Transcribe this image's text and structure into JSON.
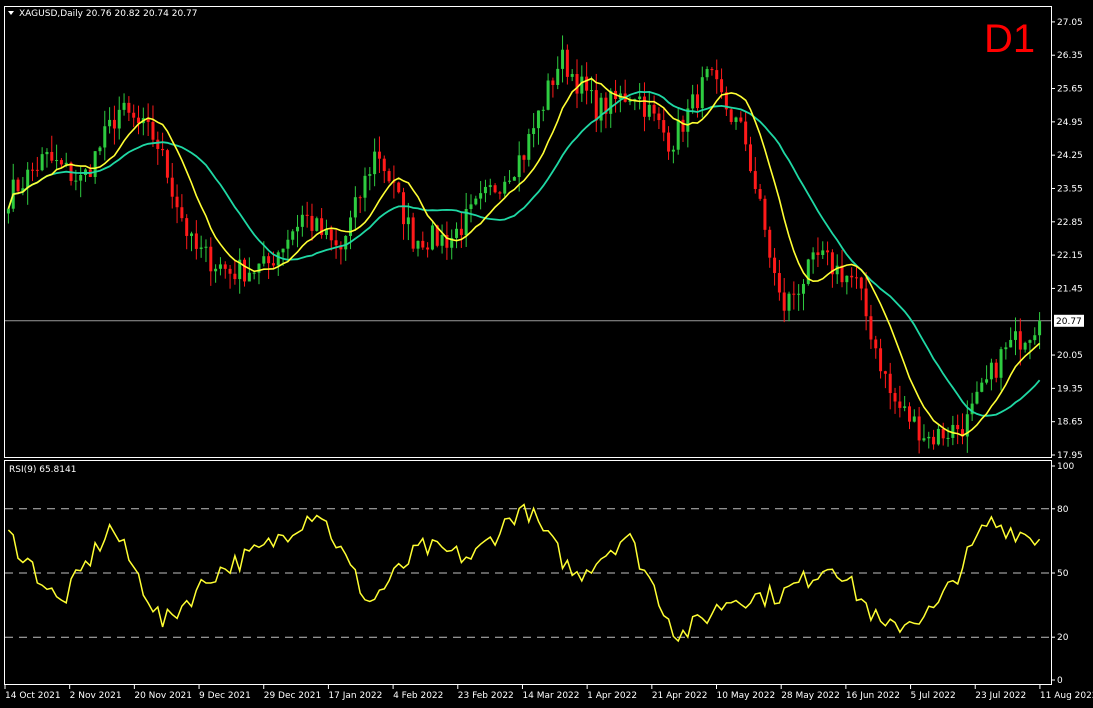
{
  "window": {
    "symbol_line": "XAGUSD,Daily  20.76 20.82 20.74 20.77",
    "timeframe_badge": "D1",
    "collapse_icon": "triangle-down-icon"
  },
  "price_scale": {
    "ticks": [
      "27.05",
      "26.35",
      "25.65",
      "24.95",
      "24.25",
      "23.55",
      "22.85",
      "22.15",
      "21.45",
      "20.05",
      "19.35",
      "18.65",
      "17.95"
    ],
    "current_price_label": "20.77"
  },
  "rsi_panel": {
    "title": "RSI(9) 65.8141",
    "ticks": [
      "100",
      "80",
      "50",
      "20",
      "0"
    ]
  },
  "time_scale": {
    "labels": [
      "14 Oct 2021",
      "2 Nov 2021",
      "20 Nov 2021",
      "9 Dec 2021",
      "29 Dec 2021",
      "17 Jan 2022",
      "4 Feb 2022",
      "23 Feb 2022",
      "14 Mar 2022",
      "1 Apr 2022",
      "21 Apr 2022",
      "10 May 2022",
      "28 May 2022",
      "16 Jun 2022",
      "5 Jul 2022",
      "23 Jul 2022",
      "11 Aug 2022"
    ]
  },
  "colors": {
    "background": "#000000",
    "bull_candle": "#2ecc40",
    "bear_candle": "#ff1a1a",
    "ma_fast": "#ffff33",
    "ma_slow": "#1fd8a4",
    "rsi_line": "#ffff33",
    "d1_badge": "#ff0000"
  },
  "chart_data": [
    {
      "type": "candlestick",
      "title": "XAGUSD,Daily",
      "series_keypoints": [
        {
          "x": "14 Oct 2021",
          "close": 23.4
        },
        {
          "x": "22 Oct 2021",
          "close": 24.2
        },
        {
          "x": "2 Nov 2021",
          "close": 23.7
        },
        {
          "x": "12 Nov 2021",
          "close": 25.2
        },
        {
          "x": "20 Nov 2021",
          "close": 24.6
        },
        {
          "x": "2 Dec 2021",
          "close": 22.3
        },
        {
          "x": "9 Dec 2021",
          "close": 21.8
        },
        {
          "x": "15 Dec 2021",
          "close": 21.9
        },
        {
          "x": "29 Dec 2021",
          "close": 23.0
        },
        {
          "x": "6 Jan 2022",
          "close": 22.2
        },
        {
          "x": "17 Jan 2022",
          "close": 24.4
        },
        {
          "x": "27 Jan 2022",
          "close": 22.5
        },
        {
          "x": "4 Feb 2022",
          "close": 22.5
        },
        {
          "x": "14 Feb 2022",
          "close": 23.4
        },
        {
          "x": "23 Feb 2022",
          "close": 24.3
        },
        {
          "x": "7 Mar 2022",
          "close": 26.3
        },
        {
          "x": "14 Mar 2022",
          "close": 25.2
        },
        {
          "x": "24 Mar 2022",
          "close": 25.6
        },
        {
          "x": "1 Apr 2022",
          "close": 24.5
        },
        {
          "x": "18 Apr 2022",
          "close": 25.9
        },
        {
          "x": "21 Apr 2022",
          "close": 24.6
        },
        {
          "x": "10 May 2022",
          "close": 21.0
        },
        {
          "x": "28 May 2022",
          "close": 22.1
        },
        {
          "x": "16 Jun 2022",
          "close": 21.6
        },
        {
          "x": "5 Jul 2022",
          "close": 19.1
        },
        {
          "x": "14 Jul 2022",
          "close": 18.3
        },
        {
          "x": "23 Jul 2022",
          "close": 18.6
        },
        {
          "x": "27 Jul 2022",
          "close": 20.1
        },
        {
          "x": "11 Aug 2022",
          "close": 20.77
        }
      ],
      "ylim": [
        17.95,
        27.3
      ],
      "current_price": 20.77,
      "moving_averages": [
        {
          "color": "#ffff33"
        },
        {
          "color": "#1fd8a4"
        }
      ],
      "grid": false
    },
    {
      "type": "line",
      "title": "RSI(9) 65.8141",
      "ylim": [
        0,
        100
      ],
      "levels": [
        80,
        50,
        20
      ],
      "x": [
        "14 Oct 2021",
        "2 Nov 2021",
        "20 Nov 2021",
        "9 Dec 2021",
        "29 Dec 2021",
        "17 Jan 2022",
        "4 Feb 2022",
        "23 Feb 2022",
        "14 Mar 2022",
        "1 Apr 2022",
        "21 Apr 2022",
        "10 May 2022",
        "28 May 2022",
        "16 Jun 2022",
        "5 Jul 2022",
        "23 Jul 2022",
        "11 Aug 2022"
      ],
      "values": [
        68,
        35,
        72,
        26,
        50,
        62,
        80,
        36,
        62,
        57,
        82,
        48,
        68,
        20,
        38,
        40,
        55,
        23,
        33,
        74,
        65.8
      ]
    }
  ]
}
